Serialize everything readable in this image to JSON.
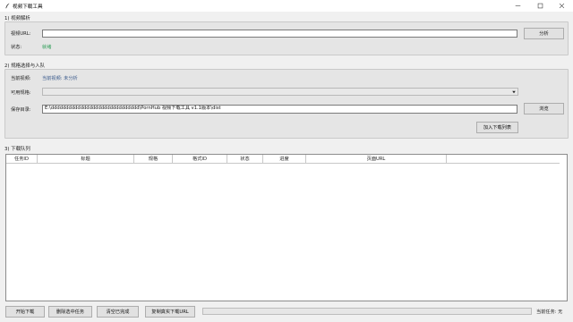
{
  "window": {
    "title": "视频下载工具",
    "icon": "feather-icon"
  },
  "parse_section": {
    "heading": "1) 视频解析",
    "url_label": "视频URL:",
    "url_value": "",
    "analyze_label": "分析",
    "status_label": "状态:",
    "status_value": "就绪",
    "status_color": "#2e9d57"
  },
  "queue_add_section": {
    "heading": "2) 规格选择与入队",
    "current_video_label": "当前视频:",
    "current_video_value": "当前视频: 未分析",
    "formats_label": "可用规格:",
    "formats_selected": "",
    "save_dir_label": "保存目录:",
    "save_dir_value": "E:\\dddddddddddddddddddddddddddddd\\PornHub 视频下载工具 v1.1版本\\dist",
    "browse_label": "浏览",
    "enqueue_label": "加入下载列表"
  },
  "queue_section": {
    "heading": "3) 下载队列",
    "columns": [
      "任务ID",
      "标题",
      "规格",
      "格式ID",
      "状态",
      "进度",
      "页面URL",
      ""
    ],
    "rows": []
  },
  "footer": {
    "start_label": "开始下载",
    "delete_label": "删除选中任务",
    "clear_label": "清空已完成",
    "copy_label": "复制真实下载URL",
    "progress_percent": 0,
    "progress_color": "#06b025",
    "current_task_text": "当前任务: 无"
  }
}
